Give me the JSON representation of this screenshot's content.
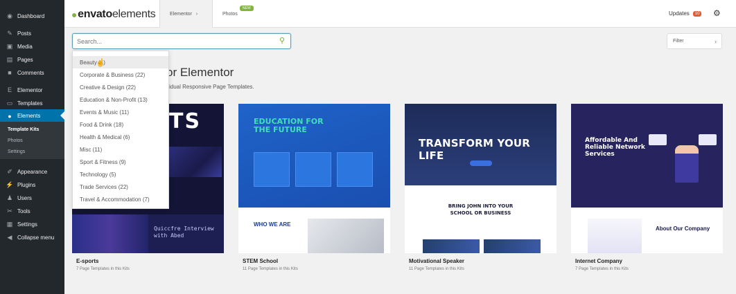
{
  "sidebar": {
    "items": [
      {
        "label": "Dashboard",
        "icon": "dashboard-icon"
      },
      {
        "label": "Posts",
        "icon": "pin-icon"
      },
      {
        "label": "Media",
        "icon": "media-icon"
      },
      {
        "label": "Pages",
        "icon": "pages-icon"
      },
      {
        "label": "Comments",
        "icon": "comments-icon"
      },
      {
        "label": "Elementor",
        "icon": "elementor-icon"
      },
      {
        "label": "Templates",
        "icon": "folder-icon"
      },
      {
        "label": "Elements",
        "icon": "leaf-icon"
      },
      {
        "label": "Appearance",
        "icon": "brush-icon"
      },
      {
        "label": "Plugins",
        "icon": "plug-icon"
      },
      {
        "label": "Users",
        "icon": "user-icon"
      },
      {
        "label": "Tools",
        "icon": "wrench-icon"
      },
      {
        "label": "Settings",
        "icon": "settings-icon"
      },
      {
        "label": "Collapse menu",
        "icon": "collapse-icon"
      }
    ],
    "submenu": [
      "Template Kits",
      "Photos",
      "Settings"
    ]
  },
  "header": {
    "logo": "envatoelements",
    "logo_bold": "envato",
    "logo_light": "elements",
    "tab_elementor": "Elementor",
    "tab_elementor_chevron": "›",
    "tab_photos": "Photos",
    "new_badge": "NEW",
    "updates_label": "Updates",
    "updates_count": "10"
  },
  "search": {
    "placeholder": "Search...",
    "filter_label": "Filter",
    "filter_chevron": "›"
  },
  "page": {
    "heading": "or Elementor",
    "subheading": "vidual Responsive Page Templates."
  },
  "dropdown": {
    "items": [
      "Beauty (1)",
      "Corporate & Business (22)",
      "Creative & Design (22)",
      "Education & Non-Profit (13)",
      "Events & Music (11)",
      "Food & Drink (18)",
      "Health & Medical (6)",
      "Misc (11)",
      "Sport & Fitness (9)",
      "Technology (5)",
      "Trade Services (22)",
      "Travel & Accommodation (7)"
    ]
  },
  "cards": [
    {
      "title": "E-sports",
      "meta": "7 Page Templates in this Kits",
      "preview_big": "TS",
      "preview_text": "Quiccfre Interview with Abed"
    },
    {
      "title": "STEM School",
      "meta": "11 Page Templates in this Kits",
      "preview_heading": "EDUCATION FOR THE FUTURE",
      "preview_section": "WHO WE ARE"
    },
    {
      "title": "Motivational Speaker",
      "meta": "11 Page Templates in this Kits",
      "preview_heading": "TRANSFORM YOUR LIFE",
      "preview_sub": "BRING JOHN INTO YOUR SCHOOL OR BUSINESS"
    },
    {
      "title": "Internet Company",
      "meta": "7 Page Templates in this Kits",
      "preview_heading": "Affordable And Reliable Network Services",
      "preview_about": "About Our Company"
    }
  ],
  "colors": {
    "sidebar_bg": "#23282d",
    "sidebar_active": "#0073aa",
    "brand_green": "#82b440",
    "updates_badge": "#e25d33"
  }
}
